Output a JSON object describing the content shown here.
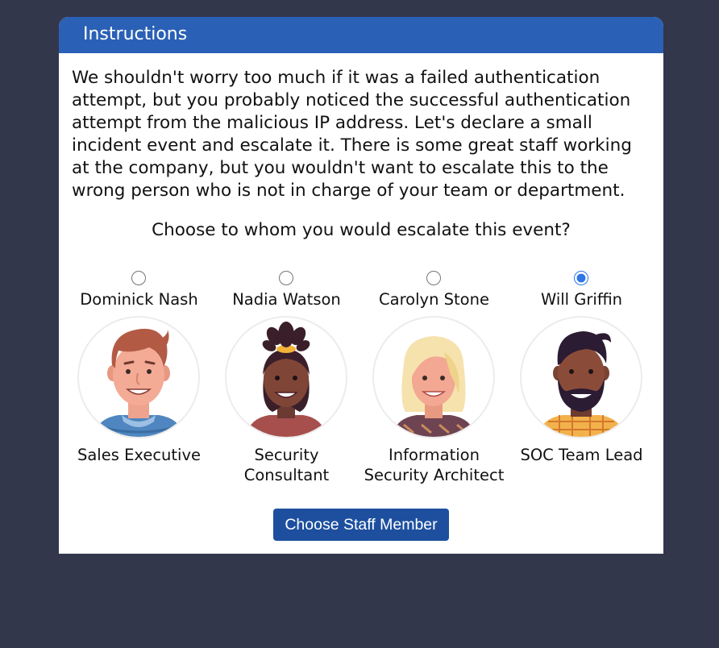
{
  "header": {
    "title": "Instructions"
  },
  "body": {
    "paragraph": "We shouldn't worry too much if it was a failed authentication attempt, but you probably noticed the successful authentication attempt from the malicious IP address. Let's declare a small incident event and escalate it. There is some great staff working at the company, but you wouldn't want to escalate this to the wrong person who is not in charge of your team or department.",
    "question": "Choose to whom you would escalate this event?"
  },
  "staff": [
    {
      "name": "Dominick Nash",
      "role": "Sales Executive",
      "selected": false,
      "avatar": "man-brown-hair-blue-shirt-avatar"
    },
    {
      "name": "Nadia Watson",
      "role": "Security Consultant",
      "selected": false,
      "avatar": "woman-hair-bun-avatar"
    },
    {
      "name": "Carolyn Stone",
      "role": "Information Security Architect",
      "selected": false,
      "avatar": "woman-blonde-hair-avatar"
    },
    {
      "name": "Will Griffin",
      "role": "SOC Team Lead",
      "selected": true,
      "avatar": "man-beard-avatar"
    }
  ],
  "submit_label": "Choose Staff Member",
  "colors": {
    "background": "#33374b",
    "header": "#2a60b6",
    "button": "#1d4f9e",
    "radio_selected": "#2f76e8"
  }
}
